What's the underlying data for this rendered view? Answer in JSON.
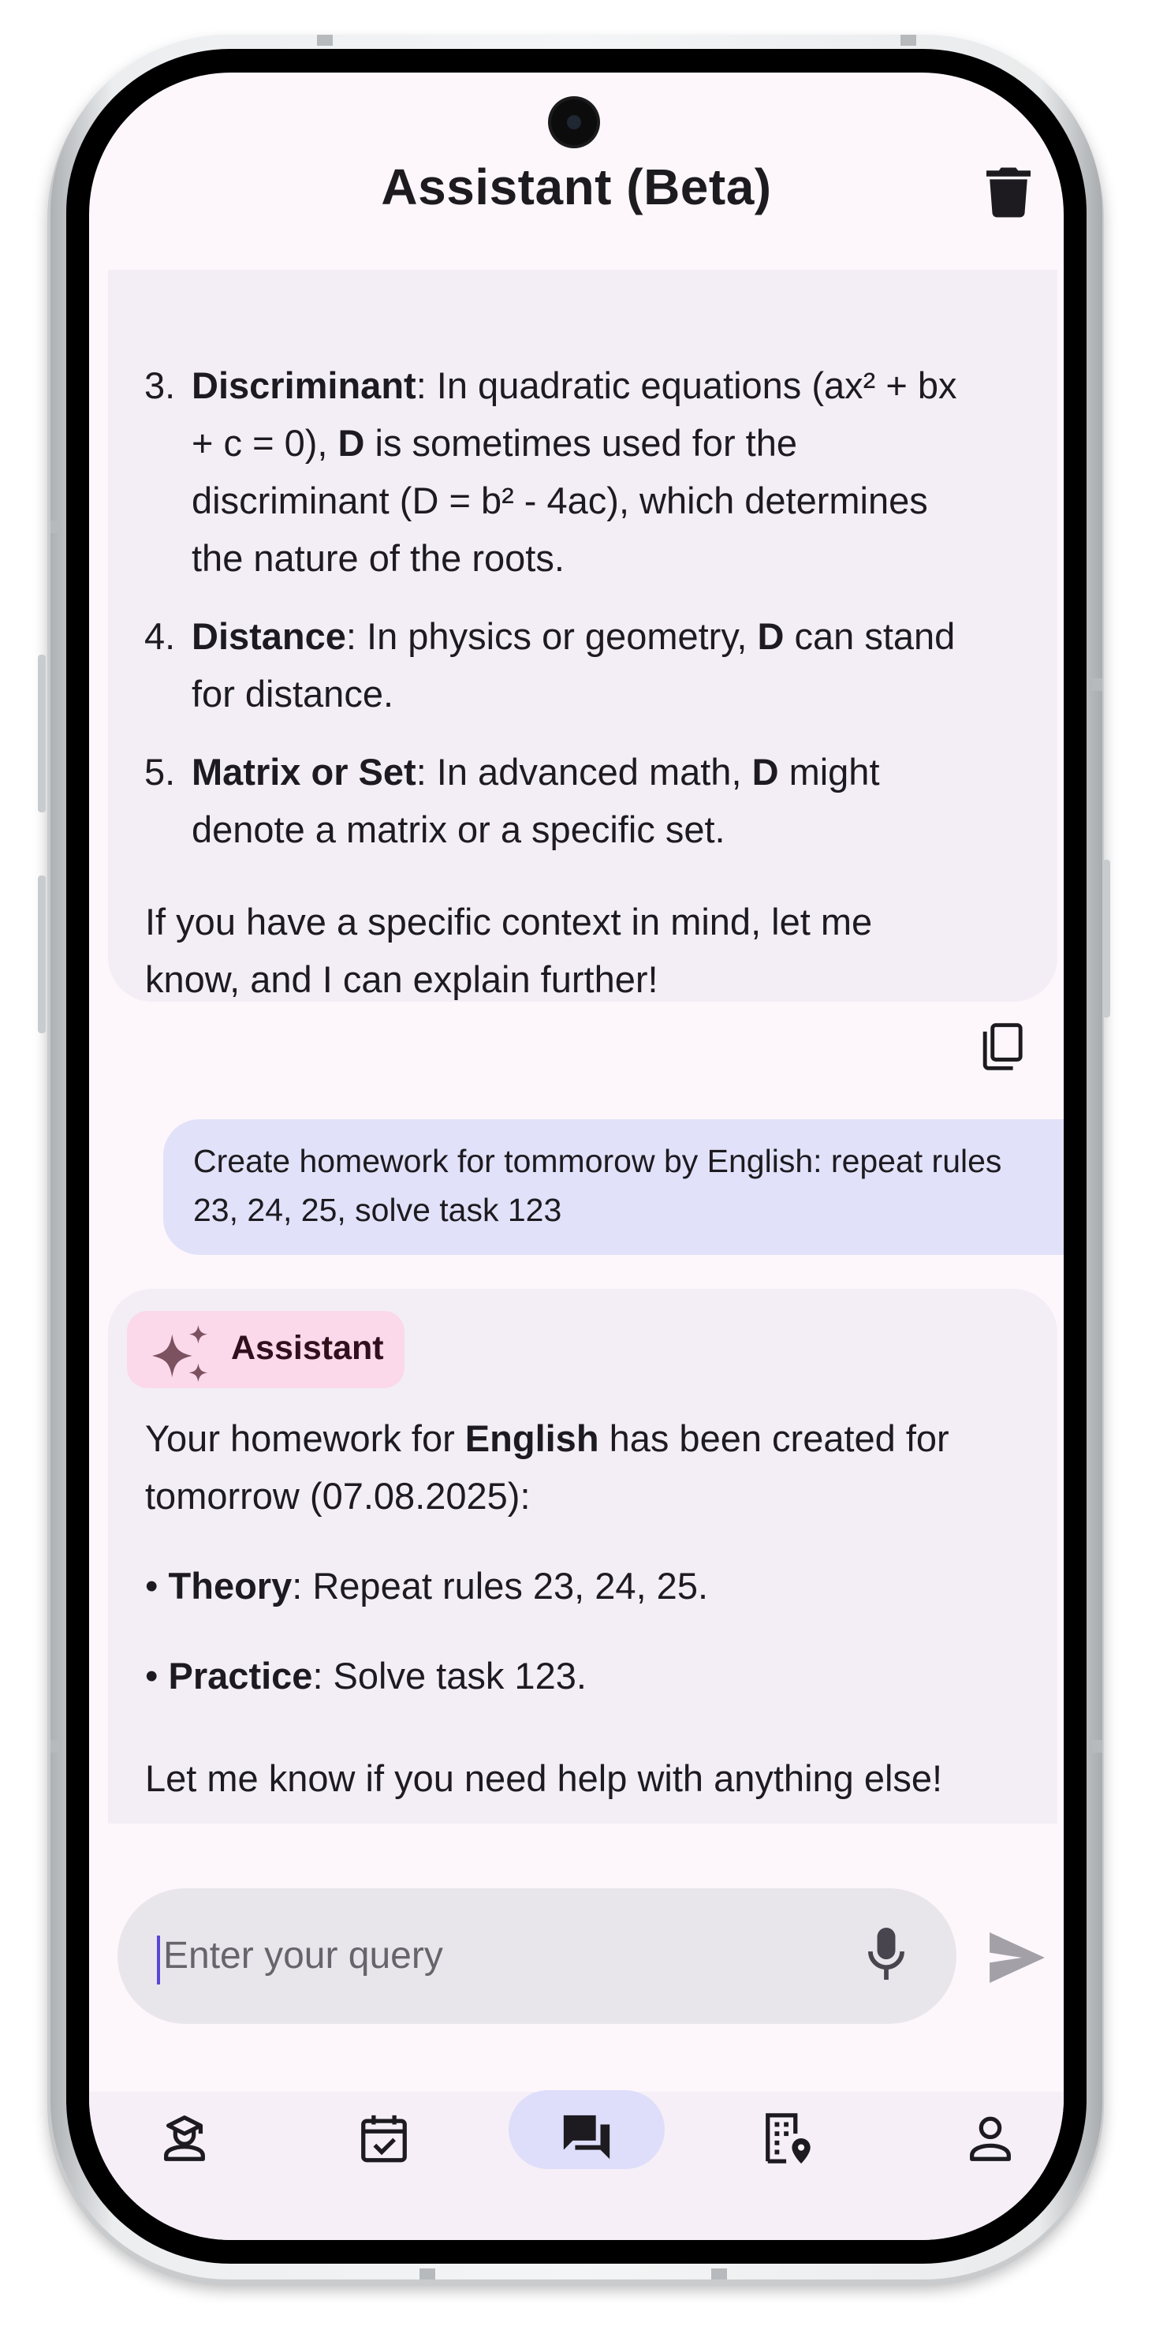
{
  "app": {
    "title": "Assistant (Beta)"
  },
  "chat": {
    "previous_answer": {
      "items": [
        {
          "number": "3.",
          "term": "Discriminant",
          "line1_rest": ": In quadratic equations (ax² + bx",
          "line2_pre": "+ c = 0), ",
          "line2_bold": "D",
          "line2_post": " is sometimes used for the",
          "line3": "discriminant (D = b² - 4ac), which determines",
          "line4": "the nature of the roots."
        },
        {
          "number": "4.",
          "term": "Distance",
          "line1_mid": ": In physics or geometry, ",
          "line1_bold": "D",
          "line1_post": " can stand",
          "line2": "for distance."
        },
        {
          "number": "5.",
          "term": "Matrix or Set",
          "line1_mid": ": In advanced math, ",
          "line1_bold": "D",
          "line1_post": " might",
          "line2": "denote a matrix or a specific set."
        }
      ],
      "closing_line1": "If you have a specific context in mind, let me",
      "closing_line2": "know, and I can explain further!"
    },
    "user_message": {
      "line1": "Create homework for tommorow by English: repeat rules",
      "line2": "23, 24, 25, solve task 123"
    },
    "assistant_reply": {
      "sender_label": "Assistant",
      "intro_pre": "Your homework for ",
      "intro_bold": "English",
      "intro_post": " has been created for",
      "intro_line2": "tomorrow (07.08.2025):",
      "bullet": "•",
      "theory_label": "Theory",
      "theory_text": ": Repeat rules 23, 24, 25.",
      "practice_label": "Practice",
      "practice_text": ": Solve task 123.",
      "closing": "Let me know if you need help with anything else!"
    }
  },
  "composer": {
    "placeholder": "Enter your query"
  },
  "nav": {
    "items": [
      {
        "icon": "graduation-person-icon"
      },
      {
        "icon": "calendar-check-icon"
      },
      {
        "icon": "chat-bubbles-icon",
        "active": true
      },
      {
        "icon": "building-location-icon"
      },
      {
        "icon": "person-icon"
      }
    ]
  },
  "colors": {
    "screen_bg": "#fdf7fc",
    "assistant_bubble": "#f3eef6",
    "user_bubble": "#e1e1f9",
    "assistant_chip": "#fbd9ea",
    "nav_active_pill": "#dedefa",
    "text": "#1d1b20"
  }
}
